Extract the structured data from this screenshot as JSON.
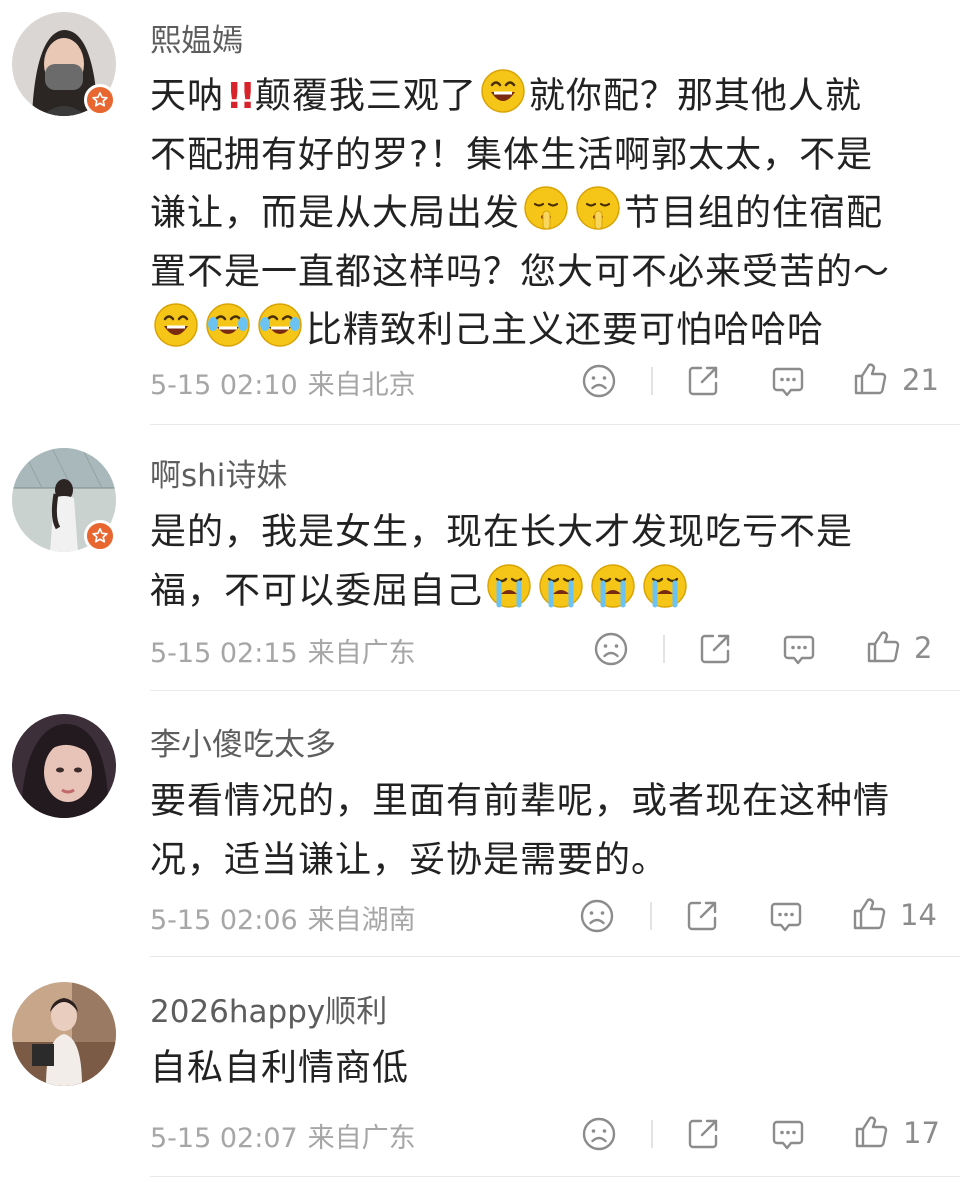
{
  "comments": [
    {
      "username": "熙媪嫣",
      "lines": [
        "天呐",
        "!!",
        "颠覆我三观了",
        "就你配？那其他人就",
        "不配拥有好的罗?！集体生活啊郭太太，不是",
        "谦让，而是从大局出发",
        "节目组的住宿配",
        "置不是一直都这样吗？您大可不必来受苦的～",
        "比精致利己主义还要可怕哈哈哈"
      ],
      "time": "5-15 02:10",
      "location": "来自北京",
      "likes": "21",
      "verified": true
    },
    {
      "username": "啊shi诗妹",
      "lines": [
        "是的，我是女生，现在长大才发现吃亏不是",
        "福，不可以委屈自己"
      ],
      "time": "5-15 02:15",
      "location": "来自广东",
      "likes": "2",
      "verified": true
    },
    {
      "username": "李小傻吃太多",
      "lines": [
        "要看情况的，里面有前辈呢，或者现在这种情",
        "况，适当谦让，妥协是需要的。"
      ],
      "time": "5-15 02:06",
      "location": "来自湖南",
      "likes": "14",
      "verified": false
    },
    {
      "username": "2026happy顺利",
      "lines": [
        "自私自利情商低"
      ],
      "time": "5-15 02:07",
      "location": "来自广东",
      "likes": "17",
      "verified": false
    }
  ],
  "icons": {
    "dislike": "frown-face-icon",
    "share": "share-icon",
    "comment": "comment-bubble-icon",
    "like": "thumbs-up-icon",
    "verified": "verified-badge-icon"
  },
  "colors": {
    "badge": "#e8662f",
    "emoji": "#f5c518",
    "bang": "#d8232a"
  }
}
